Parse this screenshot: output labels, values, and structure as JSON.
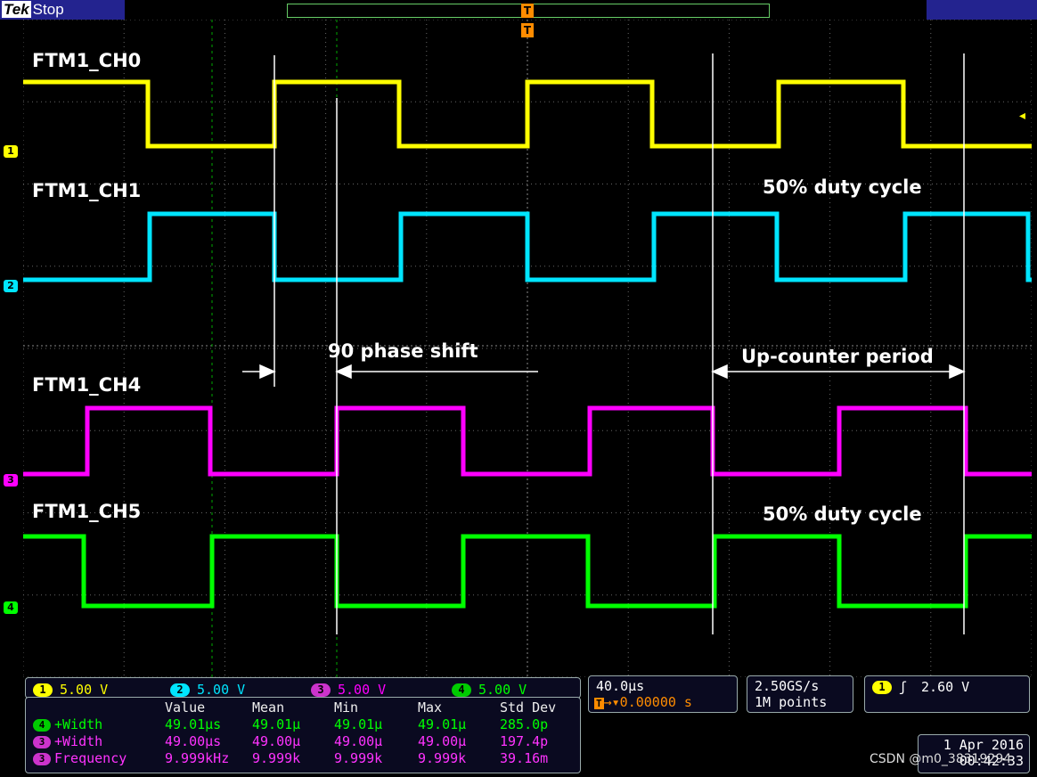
{
  "header": {
    "brand": "Tek",
    "status": "Stop",
    "trigger_marker": "T"
  },
  "channels": [
    {
      "id": "1",
      "label": "FTM1_CH0",
      "color": "#ffff00"
    },
    {
      "id": "2",
      "label": "FTM1_CH1",
      "color": "#00e5ff"
    },
    {
      "id": "3",
      "label": "FTM1_CH4",
      "color": "#ff00ff"
    },
    {
      "id": "4",
      "label": "FTM1_CH5",
      "color": "#00ff00"
    }
  ],
  "annotations": {
    "duty_top": "50% duty cycle",
    "phase": "90 phase shift",
    "period": "Up-counter period",
    "duty_bottom": "50% duty cycle"
  },
  "vertical": [
    {
      "ch": "1",
      "scale": "5.00 V"
    },
    {
      "ch": "2",
      "scale": "5.00 V"
    },
    {
      "ch": "3",
      "scale": "5.00 V"
    },
    {
      "ch": "4",
      "scale": "5.00 V"
    }
  ],
  "horizontal": {
    "scale": "40.0µs",
    "position": "▾0.00000 s"
  },
  "acquisition": {
    "rate": "2.50GS/s",
    "points": "1M points"
  },
  "trigger": {
    "ch": "1",
    "slope": "ʃ",
    "level": "2.60 V"
  },
  "date": {
    "day": "1 Apr 2016",
    "time": "00:42:33"
  },
  "measurements": {
    "headers": [
      "",
      "Value",
      "Mean",
      "Min",
      "Max",
      "Std Dev"
    ],
    "rows": [
      {
        "ch": "4",
        "name": "+Width",
        "cells": [
          "49.01µs",
          "49.01µ",
          "49.01µ",
          "49.01µ",
          "285.0p"
        ]
      },
      {
        "ch": "3",
        "name": "+Width",
        "cells": [
          "49.00µs",
          "49.00µ",
          "49.00µ",
          "49.00µ",
          "197.4p"
        ]
      },
      {
        "ch": "3",
        "name": "Frequency",
        "cells": [
          "9.999kHz",
          "9.999k",
          "9.999k",
          "9.999k",
          "39.16m"
        ]
      }
    ]
  },
  "watermark": "CSDN @m0_38319294"
}
